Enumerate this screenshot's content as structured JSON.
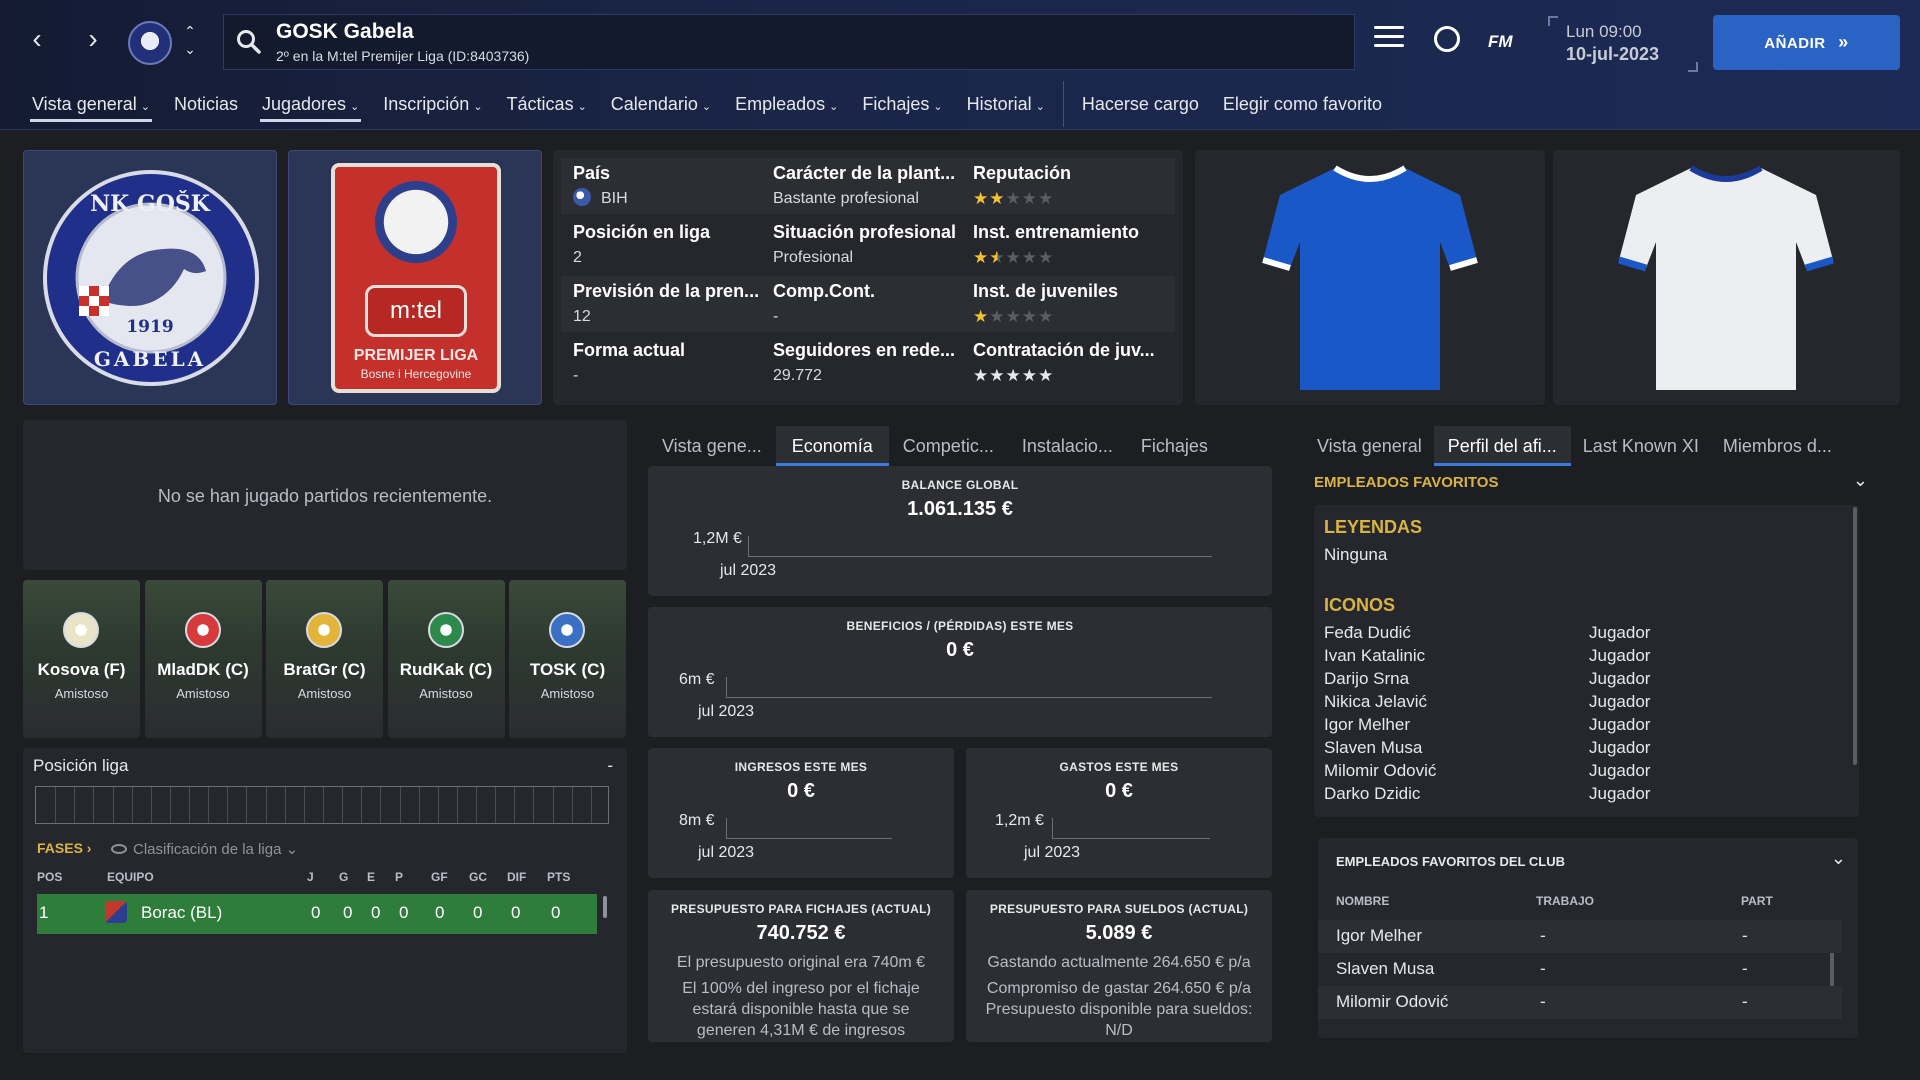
{
  "header": {
    "club_name": "GOSK Gabela",
    "club_subtitle": "2º en la M:tel Premijer Liga (ID:8403736)",
    "time": "Lun 09:00",
    "date": "10-jul-2023",
    "fm_logo": "FM",
    "add_button": "AÑADIR",
    "back_icon": "‹",
    "forward_icon": "›",
    "up_icon": "⌃",
    "down_icon": "⌄",
    "add_chevrons": "»"
  },
  "nav": {
    "items": [
      {
        "label": "Vista general",
        "chevron": true,
        "active": true
      },
      {
        "label": "Noticias",
        "chevron": false
      },
      {
        "label": "Jugadores",
        "chevron": true,
        "active": true
      },
      {
        "label": "Inscripción",
        "chevron": true
      },
      {
        "label": "Tácticas",
        "chevron": true
      },
      {
        "label": "Calendario",
        "chevron": true
      },
      {
        "label": "Empleados",
        "chevron": true
      },
      {
        "label": "Fichajes",
        "chevron": true
      },
      {
        "label": "Historial",
        "chevron": true
      }
    ],
    "actions": [
      "Hacerse cargo",
      "Elegir como favorito"
    ],
    "chevron_glyph": "⌄"
  },
  "crest": {
    "top_text": "NK GOŠK",
    "year": "1919",
    "bottom_text": "GABELA"
  },
  "league_badge": {
    "brand": "m:tel",
    "line1": "PREMIJER LIGA",
    "line2": "Bosne i Hercegovine"
  },
  "info": {
    "pais_label": "País",
    "pais_value": "BIH",
    "caracter_label": "Carácter de la plant...",
    "caracter_value": "Bastante profesional",
    "reputacion_label": "Reputación",
    "reputacion_stars": 2,
    "posicion_label": "Posición en liga",
    "posicion_value": "2",
    "situacion_label": "Situación profesional",
    "situacion_value": "Profesional",
    "entrenamiento_label": "Inst. entrenamiento",
    "entrenamiento_stars": 1.5,
    "prevision_label": "Previsión de la pren...",
    "prevision_value": "12",
    "compcont_label": "Comp.Cont.",
    "compcont_value": "-",
    "juveniles_label": "Inst. de juveniles",
    "juveniles_stars": 1,
    "forma_label": "Forma actual",
    "forma_value": "-",
    "seguidores_label": "Seguidores en rede...",
    "seguidores_value": "29.772",
    "contratacion_label": "Contratación de juv...",
    "contratacion_stars": 5,
    "star_glyph": "★"
  },
  "recent": {
    "empty_text": "No se han jugado partidos recientemente."
  },
  "fixtures": [
    {
      "name": "Kosova (F)",
      "type": "Amistoso",
      "color": "#e9e4c8"
    },
    {
      "name": "MladDK (C)",
      "type": "Amistoso",
      "color": "#d63a3a"
    },
    {
      "name": "BratGr (C)",
      "type": "Amistoso",
      "color": "#e2b43a"
    },
    {
      "name": "RudKak (C)",
      "type": "Amistoso",
      "color": "#2d8a4a"
    },
    {
      "name": "TOSK (C)",
      "type": "Amistoso",
      "color": "#3a6fc4"
    }
  ],
  "league_position": {
    "label": "Posición liga",
    "dash": "-",
    "fases": "FASES",
    "fases_chevron": "›",
    "standings_label": "Clasificación de la liga",
    "standings_chevron": "⌄",
    "columns": [
      "POS",
      "EQUIPO",
      "J",
      "G",
      "E",
      "P",
      "GF",
      "GC",
      "DIF",
      "PTS"
    ],
    "rows": [
      {
        "pos": "1",
        "team": "Borac (BL)",
        "j": "0",
        "g": "0",
        "e": "0",
        "p": "0",
        "gf": "0",
        "gc": "0",
        "dif": "0",
        "pts": "0"
      }
    ]
  },
  "center_tabs": [
    "Vista gene...",
    "Economía",
    "Competic...",
    "Instalacio...",
    "Fichajes"
  ],
  "finance": {
    "balance_title": "BALANCE GLOBAL",
    "balance_value": "1.061.135 €",
    "balance_axis": "1,2M €",
    "balance_month": "jul 2023",
    "profit_title": "BENEFICIOS / (PÉRDIDAS) ESTE MES",
    "profit_value": "0 €",
    "profit_axis": "6m €",
    "profit_month": "jul 2023",
    "income_title": "INGRESOS ESTE MES",
    "income_value": "0 €",
    "income_axis": "8m €",
    "income_month": "jul 2023",
    "expense_title": "GASTOS ESTE MES",
    "expense_value": "0 €",
    "expense_axis": "1,2m €",
    "expense_month": "jul 2023",
    "transfer_title": "PRESUPUESTO PARA FICHAJES (ACTUAL)",
    "transfer_value": "740.752 €",
    "transfer_note1": "El presupuesto original era 740m €",
    "transfer_note2": "El 100% del ingreso por el fichaje",
    "transfer_note3": "estará disponible hasta que se",
    "transfer_note4": "generen 4,31M € de ingresos",
    "wage_title": "PRESUPUESTO PARA SUELDOS (ACTUAL)",
    "wage_value": "5.089 €",
    "wage_note1": "Gastando actualmente 264.650 € p/a",
    "wage_note2": "Compromiso de gastar 264.650 € p/a",
    "wage_note3": "Presupuesto disponible para sueldos:",
    "wage_note4": "N/D"
  },
  "right_tabs": [
    "Vista general",
    "Perfil del afi...",
    "Last Known XI",
    "Miembros d..."
  ],
  "favorites": {
    "section_title": "EMPLEADOS FAVORITOS",
    "legends_title": "LEYENDAS",
    "legends_value": "Ninguna",
    "icons_title": "ICONOS",
    "icons": [
      {
        "name": "Feđa Dudić",
        "role": "Jugador"
      },
      {
        "name": "Ivan Katalinic",
        "role": "Jugador"
      },
      {
        "name": "Darijo Srna",
        "role": "Jugador"
      },
      {
        "name": "Nikica Jelavić",
        "role": "Jugador"
      },
      {
        "name": "Igor Melher",
        "role": "Jugador"
      },
      {
        "name": "Slaven Musa",
        "role": "Jugador"
      },
      {
        "name": "Milomir Odović",
        "role": "Jugador"
      },
      {
        "name": "Darko Dzidic",
        "role": "Jugador"
      }
    ],
    "chevron": "⌄"
  },
  "club_favorites": {
    "title": "EMPLEADOS FAVORITOS DEL CLUB",
    "columns": [
      "NOMBRE",
      "TRABAJO",
      "PART"
    ],
    "rows": [
      {
        "name": "Igor Melher",
        "job": "-",
        "part": "-"
      },
      {
        "name": "Slaven Musa",
        "job": "-",
        "part": "-"
      },
      {
        "name": "Milomir Odović",
        "job": "-",
        "part": "-"
      }
    ],
    "chevron": "⌄"
  },
  "colors": {
    "accent_blue": "#2b63c4",
    "tab_underline": "#3a7be0",
    "star_gold": "#f1c232",
    "section_yellow": "#d9b445",
    "row_green": "#2e7d3a"
  }
}
